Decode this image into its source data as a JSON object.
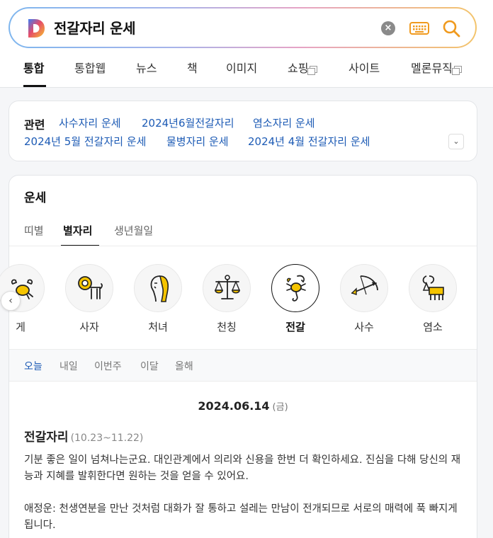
{
  "search": {
    "query": "전갈자리 운세"
  },
  "tabs": [
    {
      "label": "통합"
    },
    {
      "label": "통합웹"
    },
    {
      "label": "뉴스"
    },
    {
      "label": "책"
    },
    {
      "label": "이미지"
    },
    {
      "label": "쇼핑"
    },
    {
      "label": "사이트"
    },
    {
      "label": "멜론뮤직"
    }
  ],
  "related": {
    "title": "관련",
    "links": [
      "사수자리 운세",
      "2024년6월전갈자리",
      "염소자리 운세",
      "2024년 5월 전갈자리 운세",
      "물병자리 운세",
      "2024년 4월 전갈자리 운세"
    ]
  },
  "fortune": {
    "title": "운세",
    "subtabs": [
      "띠별",
      "별자리",
      "생년월일"
    ],
    "zodiacs": [
      {
        "label": "게",
        "icon": "cancer-icon"
      },
      {
        "label": "사자",
        "icon": "leo-icon"
      },
      {
        "label": "처녀",
        "icon": "virgo-icon"
      },
      {
        "label": "천칭",
        "icon": "libra-icon"
      },
      {
        "label": "전갈",
        "icon": "scorpio-icon",
        "selected": true
      },
      {
        "label": "사수",
        "icon": "sagittarius-icon"
      },
      {
        "label": "염소",
        "icon": "capricorn-icon"
      }
    ],
    "periods": [
      "오늘",
      "내일",
      "이번주",
      "이달",
      "올해"
    ],
    "date": "2024.06.14",
    "day_of_week": "(금)",
    "sign_name": "전갈자리",
    "sign_range": "(10.23~11.22)",
    "paragraph1": "기분 좋은 일이 넘쳐나는군요. 대인관계에서 의리와 신용을 한번 더 확인하세요. 진심을 다해 당신의 재능과 지혜를 발휘한다면 원하는 것을 얻을 수 있어요.",
    "paragraph2": "애정운: 천생연분을 만난 것처럼 대화가 잘 통하고 설레는 만남이 전개되므로 서로의 매력에 푹 빠지게 됩니다."
  },
  "colors": {
    "accent_yellow": "#f5c400",
    "link_blue": "#1d5bb5"
  }
}
